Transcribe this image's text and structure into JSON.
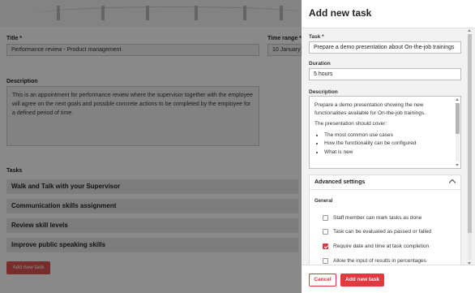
{
  "background": {
    "title_label": "Title *",
    "title_value": "Performance review  -  Product management",
    "time_range_label": "Time range *",
    "time_range_value": "10 January",
    "description_label": "Description",
    "description_value": "This is an appointment for performance review where the supervisor together with the employee will agree on the next goals and possible concrete actions to be completed by the employee for a defined period of time.",
    "tasks_label": "Tasks",
    "tasks": [
      "Walk and Talk with your Supervisor",
      "Communication skills assignment",
      "Review skill levels",
      "Improve public speaking skills"
    ],
    "add_task_button": "Add new task"
  },
  "panel": {
    "title": "Add new task",
    "task_label": "Task *",
    "task_value": "Prepare a demo presentation about On-the-job trainings",
    "duration_label": "Duration",
    "duration_value": "5 hours",
    "description_label": "Description",
    "description": {
      "paragraph1": "Prepare a demo presentation showing the new functionalities available for On-the-job trainings.",
      "paragraph2": "The presentation should cover:",
      "bullets": [
        "The most common use cases",
        "How the functionality can be configured",
        "What is new"
      ]
    },
    "advanced": {
      "title": "Advanced settings",
      "general_label": "General",
      "options": [
        {
          "label": "Staff member can mark tasks as done",
          "checked": false
        },
        {
          "label": "Task can be evaluated as passed or failed",
          "checked": false
        },
        {
          "label": "Require date and time at task completion",
          "checked": true
        },
        {
          "label": "Allow the input of results in percentages",
          "checked": false
        }
      ]
    },
    "footer": {
      "cancel": "Cancel",
      "add": "Add new task"
    }
  },
  "colors": {
    "accent": "#e03a40",
    "overlay": "#000000"
  }
}
